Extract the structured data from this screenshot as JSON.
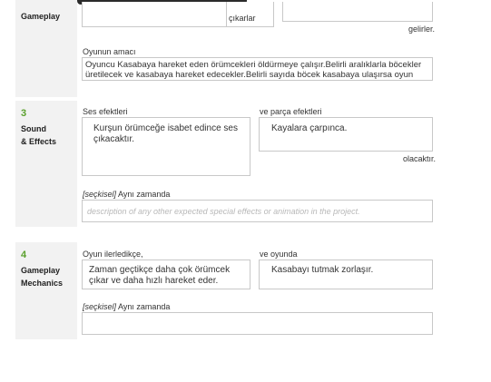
{
  "sections": {
    "gameplay": {
      "title": "Gameplay",
      "suffix_left": "çıkarlar",
      "suffix_right": "gelirler.",
      "goal_label": "Oyunun amacı",
      "goal_text": "Oyuncu Kasabaya hareket eden örümcekleri öldürmeye çalışır.Belirli aralıklarla böcekler üretilecek ve kasabaya hareket edecekler.Belirli sayıda böcek kasabaya ulaşırsa oyun kaybedilicektir."
    },
    "sound": {
      "number": "3",
      "title_line1": "Sound",
      "title_line2": "& Effects",
      "label_left": "Ses efektleri",
      "text_left": "Kurşun örümceğe isabet edince ses çıkacaktır.",
      "label_right": "ve parça efektleri",
      "text_right": "Kayalara çarpınca.",
      "suffix": "olacaktır.",
      "optional_tag": "[seçkisel]",
      "optional_label": "Aynı zamanda",
      "optional_placeholder": "description of any other expected special effects or animation in the project."
    },
    "mechanics": {
      "number": "4",
      "title_line1": "Gameplay",
      "title_line2": "Mechanics",
      "label_left": "Oyun ilerledikçe,",
      "text_left": "Zaman geçtikçe daha çok örümcek çıkar ve daha hızlı hareket eder.",
      "label_right": "ve oyunda",
      "text_right": "Kasabayı tutmak zorlaşır.",
      "optional_tag": "[seçkisel]",
      "optional_label": "Aynı zamanda",
      "optional_value": ""
    }
  }
}
